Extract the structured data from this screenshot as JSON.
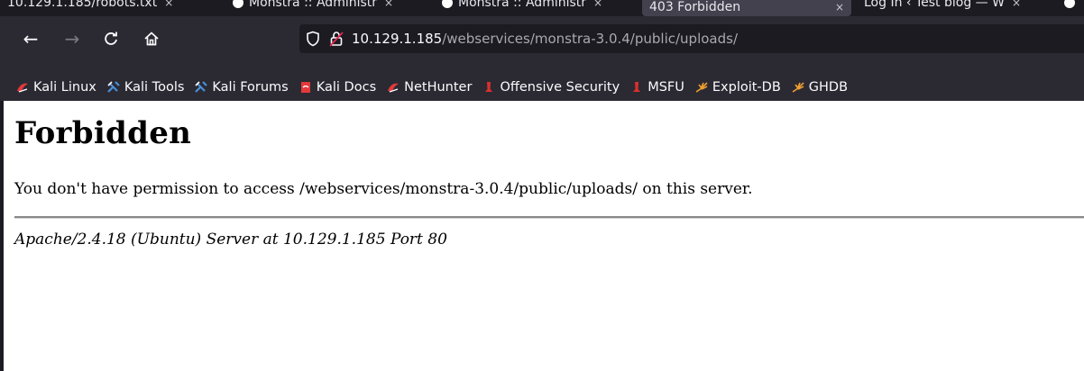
{
  "tabs": [
    {
      "label": "10.129.1.185/robots.txt",
      "close": "×",
      "has_favicon": false,
      "active": false
    },
    {
      "label": "Monstra :: Administr",
      "close": "×",
      "has_favicon": true,
      "active": false
    },
    {
      "label": "Monstra :: Administr",
      "close": "×",
      "has_favicon": true,
      "active": false
    },
    {
      "label": "403 Forbidden",
      "close": "×",
      "has_favicon": false,
      "active": true
    },
    {
      "label": "Log In ‹ Test blog — W",
      "close": "×",
      "has_favicon": false,
      "active": false
    }
  ],
  "nav": {
    "back": "←",
    "forward": "→",
    "reload": "C",
    "home": "⌂"
  },
  "url": {
    "host": "10.129.1.185",
    "path": "/webservices/monstra-3.0.4/public/uploads/"
  },
  "bookmarks": [
    {
      "label": "Kali Linux",
      "icon": "kali-dragon-icon",
      "color": "#e4393b"
    },
    {
      "label": "Kali Tools",
      "icon": "kali-tools-icon",
      "color": "#4a90d9"
    },
    {
      "label": "Kali Forums",
      "icon": "kali-forums-icon",
      "color": "#4a90d9"
    },
    {
      "label": "Kali Docs",
      "icon": "kali-docs-icon",
      "color": "#e4393b"
    },
    {
      "label": "NetHunter",
      "icon": "nethunter-icon",
      "color": "#e4393b"
    },
    {
      "label": "Offensive Security",
      "icon": "offsec-icon",
      "color": "#d9302c"
    },
    {
      "label": "MSFU",
      "icon": "msfu-icon",
      "color": "#d9302c"
    },
    {
      "label": "Exploit-DB",
      "icon": "exploitdb-icon",
      "color": "#f0a030"
    },
    {
      "label": "GHDB",
      "icon": "ghdb-icon",
      "color": "#f0a030"
    }
  ],
  "page": {
    "heading": "Forbidden",
    "message": "You don't have permission to access /webservices/monstra-3.0.4/public/uploads/ on this server.",
    "address": "Apache/2.4.18 (Ubuntu) Server at 10.129.1.185 Port 80"
  }
}
